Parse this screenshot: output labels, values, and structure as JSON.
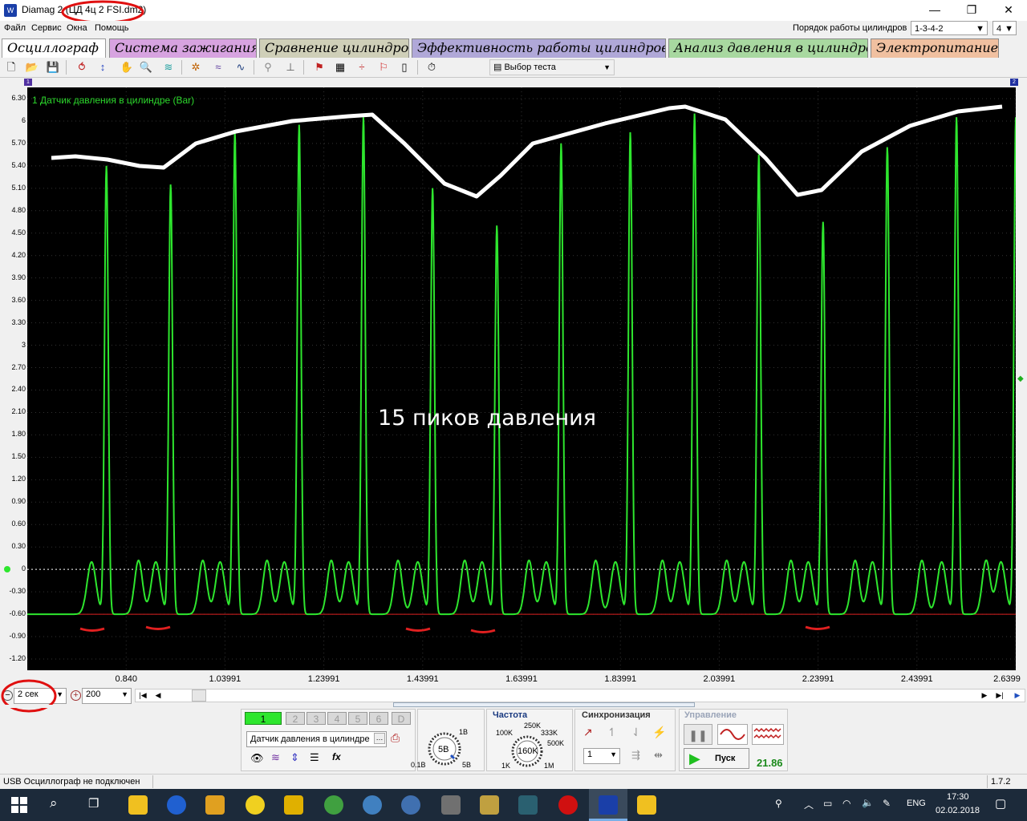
{
  "window": {
    "title": "Diamag 2 (ЦД 4ц 2 FSI.dm2)",
    "min": "—",
    "max": "❐",
    "close": "✕"
  },
  "menu": {
    "items": [
      "Файл",
      "Сервис",
      "Окна",
      "Помощь"
    ]
  },
  "cylinder_order": {
    "label": "Порядок работы цилиндров",
    "value": "1-3-4-2",
    "count": "4"
  },
  "tabs": [
    {
      "label": "Осциллограф",
      "color": "#ffffff"
    },
    {
      "label": "Система зажигания",
      "color": "#d7a3e0"
    },
    {
      "label": "Сравнение цилиндров",
      "color": "#c8c8b4"
    },
    {
      "label": "Эффективность работы цилиндров",
      "color": "#b0a8d8"
    },
    {
      "label": "Анализ давления в цилиндре",
      "color": "#a8d8a0"
    },
    {
      "label": "Электропитание",
      "color": "#f0c0a0"
    }
  ],
  "toolbar": {
    "test_select": "Выбор теста"
  },
  "scope": {
    "channel_label": "1 Датчик давления в цилиндре (Bar)",
    "annotation": "15 пиков давления",
    "trace_color": "#2ee62e",
    "zero_line_color": "#ffffff",
    "min_line_color": "#dd2020",
    "y_ticks": [
      "6.30",
      "6",
      "5.70",
      "5.40",
      "5.10",
      "4.80",
      "4.50",
      "4.20",
      "3.90",
      "3.60",
      "3.30",
      "3",
      "2.70",
      "2.40",
      "2.10",
      "1.80",
      "1.50",
      "1.20",
      "0.90",
      "0.60",
      "0.30",
      "0",
      "-0.30",
      "-0.60",
      "-0.90",
      "-1.20"
    ],
    "x_ticks": [
      "0.840",
      "1.03991",
      "1.23991",
      "1.43991",
      "1.63991",
      "1.83991",
      "2.03991",
      "2.23991",
      "2.43991",
      "2.6399"
    ],
    "markers": {
      "top_left": "1",
      "top_right": "2"
    }
  },
  "time_controls": {
    "timebase": "2 сек",
    "points": "200"
  },
  "channels": {
    "buttons": [
      "1",
      "2",
      "3",
      "4",
      "5",
      "6",
      "D"
    ],
    "sensor": "Датчик давления в цилиндре"
  },
  "range": {
    "value": "5В",
    "min": "0.1В",
    "max": "5В",
    "step": "1В"
  },
  "frequency": {
    "title": "Частота",
    "value": "160K",
    "labels": [
      "100K",
      "250K",
      "333K",
      "500K",
      "1K",
      "1M"
    ]
  },
  "sync": {
    "title": "Синхронизация",
    "value": "1"
  },
  "control": {
    "title": "Управление",
    "start_label": "Пуск",
    "value": "21.86"
  },
  "status": {
    "text": "USB Осциллограф не подключен",
    "version": "1.7.2"
  },
  "taskbar": {
    "lang": "ENG",
    "time": "17:30",
    "date": "02.02.2018"
  },
  "chart_data": {
    "type": "line",
    "title": "",
    "ylabel": "Bar",
    "xlabel": "",
    "ylim": [
      -1.35,
      6.45
    ],
    "xlim": [
      0.6399,
      2.6399
    ],
    "series": [
      {
        "name": "1 Датчик давления в цилиндре (Bar)",
        "peaks_x": [
          0.8,
          0.93,
          1.06,
          1.19,
          1.32,
          1.46,
          1.59,
          1.72,
          1.86,
          1.99,
          2.12,
          2.25,
          2.38,
          2.52,
          2.64
        ],
        "peaks_y": [
          5.4,
          5.15,
          5.85,
          5.95,
          6.05,
          5.1,
          4.6,
          5.7,
          5.85,
          6.1,
          5.55,
          4.65,
          5.65,
          6.05,
          6.05
        ],
        "baseline": -0.6
      }
    ]
  }
}
